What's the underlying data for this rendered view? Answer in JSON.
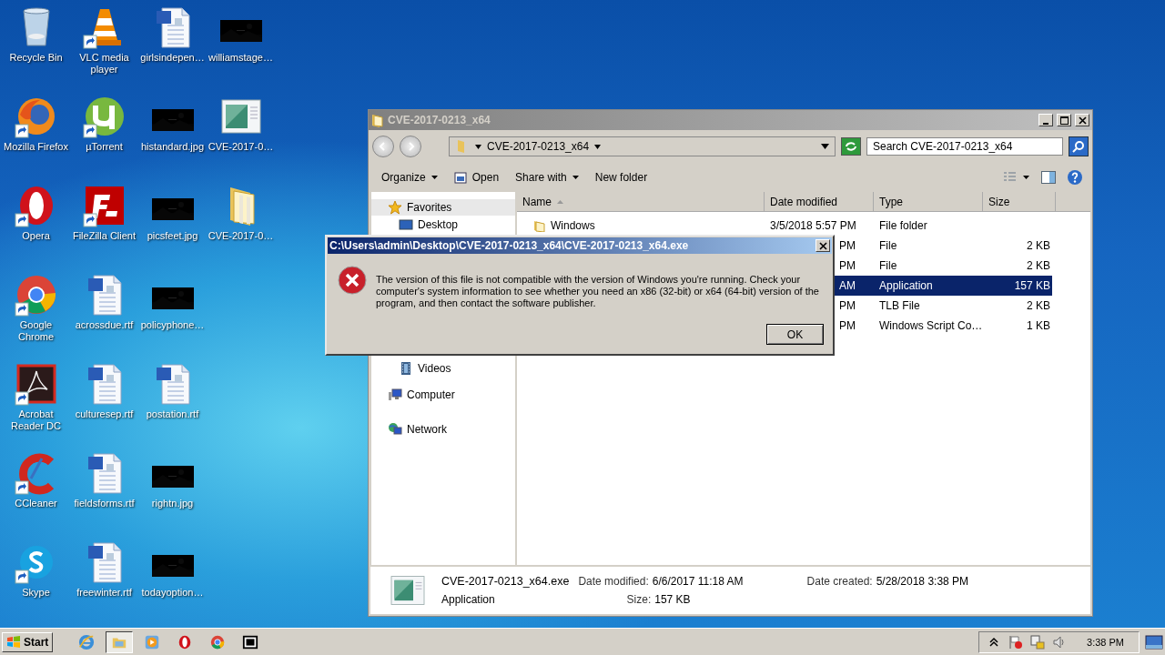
{
  "desktop_icons": [
    {
      "label": "Recycle Bin",
      "kind": "recycle",
      "shortcut": false
    },
    {
      "label": "Mozilla Firefox",
      "kind": "firefox",
      "shortcut": true
    },
    {
      "label": "Opera",
      "kind": "opera",
      "shortcut": true
    },
    {
      "label": "Google Chrome",
      "kind": "chrome",
      "shortcut": true
    },
    {
      "label": "Acrobat Reader DC",
      "kind": "acrobat",
      "shortcut": true
    },
    {
      "label": "CCleaner",
      "kind": "ccleaner",
      "shortcut": true
    },
    {
      "label": "Skype",
      "kind": "skype",
      "shortcut": true
    },
    {
      "label": "VLC media player",
      "kind": "vlc",
      "shortcut": true
    },
    {
      "label": "µTorrent",
      "kind": "utorrent",
      "shortcut": true
    },
    {
      "label": "FileZilla Client",
      "kind": "filezilla",
      "shortcut": true
    },
    {
      "label": "acrossdue.rtf",
      "kind": "word",
      "shortcut": false
    },
    {
      "label": "culturesep.rtf",
      "kind": "word",
      "shortcut": false
    },
    {
      "label": "fieldsforms.rtf",
      "kind": "word",
      "shortcut": false
    },
    {
      "label": "freewinter.rtf",
      "kind": "word",
      "shortcut": false
    },
    {
      "label": "girlsindepen…",
      "kind": "word",
      "shortcut": false
    },
    {
      "label": "histandard.jpg",
      "shortcut": false
    },
    {
      "label": "picsfeet.jpg",
      "shortcut": false
    },
    {
      "label": "policyphone…",
      "shortcut": false
    },
    {
      "label": "postation.rtf",
      "kind": "word",
      "shortcut": false
    },
    {
      "label": "rightn.jpg",
      "shortcut": false
    },
    {
      "label": "todayoption…",
      "shortcut": false
    },
    {
      "label": "williamstage…",
      "shortcut": false
    },
    {
      "label": "CVE-2017-0…",
      "kind": "exe",
      "shortcut": false
    },
    {
      "label": "CVE-2017-0…",
      "kind": "folder",
      "shortcut": false
    }
  ],
  "explorer": {
    "title": "CVE-2017-0213_x64",
    "address": "CVE-2017-0213_x64",
    "search": {
      "placeholder": "Search CVE-2017-0213_x64"
    },
    "toolbar": [
      {
        "label": "Organize",
        "kind": "menu"
      },
      {
        "label": "Open",
        "kind": "open"
      },
      {
        "label": "Share with",
        "kind": "menu"
      },
      {
        "label": "New folder",
        "kind": "plain"
      }
    ],
    "sidebar": {
      "items": [
        {
          "label": "Favorites",
          "kind": "star",
          "selected": true
        },
        {
          "label": "Desktop",
          "kind": "desktop",
          "selected": false
        },
        {
          "label": "Videos",
          "kind": "videos",
          "selected": false
        },
        {
          "label": "Computer",
          "kind": "computer",
          "selected": false
        },
        {
          "label": "Network",
          "kind": "network",
          "selected": false
        }
      ]
    },
    "columns": [
      {
        "label": "Name",
        "sorted": true
      },
      {
        "label": "Date modified",
        "sorted": false
      },
      {
        "label": "Type",
        "sorted": false
      },
      {
        "label": "Size",
        "sorted": false
      }
    ],
    "rows": [
      {
        "kind": "folder",
        "name": "Windows",
        "date": "3/5/2018 5:57 PM",
        "type": "File folder",
        "selected": false
      },
      {
        "kind": "covered",
        "date": "PM",
        "type": "File",
        "size": "2 KB",
        "selected": false
      },
      {
        "kind": "covered",
        "date": "PM",
        "type": "File",
        "size": "2 KB",
        "selected": false
      },
      {
        "kind": "covered",
        "date": "AM",
        "type": "Application",
        "size": "157 KB",
        "selected": true
      },
      {
        "kind": "covered",
        "date": "PM",
        "type": "TLB File",
        "size": "2 KB",
        "selected": false
      },
      {
        "kind": "covered",
        "date": "PM",
        "type": "Windows Script Co…",
        "size": "1 KB",
        "selected": false
      }
    ],
    "details": {
      "name": "CVE-2017-0213_x64.exe",
      "type": "Application",
      "modified_label": "Date modified:",
      "modified": "6/6/2017 11:18 AM",
      "created_label": "Date created:",
      "created": "5/28/2018 3:38 PM",
      "size_label": "Size:",
      "size": "157 KB"
    }
  },
  "dialog": {
    "title": "C:\\Users\\admin\\Desktop\\CVE-2017-0213_x64\\CVE-2017-0213_x64.exe",
    "message": "The version of this file is not compatible with the version of Windows you're running. Check your computer's system information to see whether you need an x86 (32-bit) or x64 (64-bit) version of the program, and then contact the software publisher.",
    "button": "OK"
  },
  "taskbar": {
    "start": "Start",
    "apps": [
      {
        "kind": "ie",
        "active": false
      },
      {
        "kind": "explorer",
        "active": true
      },
      {
        "kind": "media",
        "active": false
      },
      {
        "kind": "opera",
        "active": false
      },
      {
        "kind": "chrome",
        "active": false
      },
      {
        "kind": "archive",
        "active": false
      }
    ],
    "clock": "3:38 PM"
  }
}
